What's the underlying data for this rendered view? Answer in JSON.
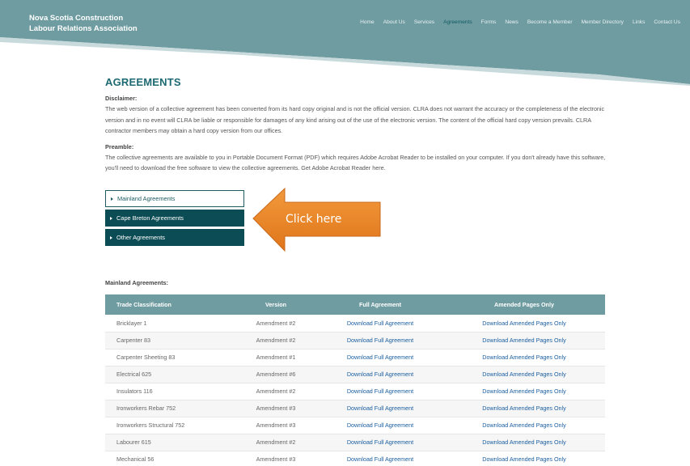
{
  "site": {
    "name_line1": "Nova Scotia Construction",
    "name_line2": "Labour Relations Association"
  },
  "nav": [
    {
      "label": "Home"
    },
    {
      "label": "About Us"
    },
    {
      "label": "Services"
    },
    {
      "label": "Agreements",
      "active": true
    },
    {
      "label": "Forms"
    },
    {
      "label": "News"
    },
    {
      "label": "Become a Member"
    },
    {
      "label": "Member Directory"
    },
    {
      "label": "Links"
    },
    {
      "label": "Contact Us"
    }
  ],
  "page": {
    "title": "AGREEMENTS",
    "disclaimer_label": "Disclaimer:",
    "disclaimer_text": "The web version of a collective agreement has been converted from its hard copy original and is not the official version. CLRA does not warrant the accuracy or the completeness of the electronic version and in no event will CLRA be liable or responsible for damages of any kind arising out of the use of the electronic version. The content of the official hard copy version prevails. CLRA contractor members may obtain a hard copy version from our offices.",
    "preamble_label": "Preamble:",
    "preamble_text": "The collective agreements are available to you in Portable Document Format (PDF) which requires Adobe Acrobat Reader to be installed on your computer. If you don't already have this software, you'll need to download the free software to view the collective agreements. Get Adobe Acrobat Reader here."
  },
  "accordion": [
    {
      "label": "Mainland Agreements"
    },
    {
      "label": "Cape Breton Agreements"
    },
    {
      "label": "Other Agreements"
    }
  ],
  "callout": {
    "text": "Click here",
    "color": "#ee8a2a"
  },
  "table": {
    "label": "Mainland Agreements:",
    "headers": [
      "Trade Classification",
      "Version",
      "Full Agreement",
      "Amended Pages Only"
    ],
    "rows": [
      {
        "trade": "Bricklayer 1",
        "version": "Amendment #2",
        "full": "Download Full Agreement",
        "amended": "Download Amended Pages Only"
      },
      {
        "trade": "Carpenter 83",
        "version": "Amendment #2",
        "full": "Download Full Agreement",
        "amended": "Download Amended Pages Only"
      },
      {
        "trade": "Carpenter Sheeting 83",
        "version": "Amendment #1",
        "full": "Download Full Agreement",
        "amended": "Download Amended Pages Only"
      },
      {
        "trade": "Electrical 625",
        "version": "Amendment #6",
        "full": "Download Full Agreement",
        "amended": "Download Amended Pages Only"
      },
      {
        "trade": "Insulators 116",
        "version": "Amendment #2",
        "full": "Download Full Agreement",
        "amended": "Download Amended Pages Only"
      },
      {
        "trade": "Ironworkers Rebar 752",
        "version": "Amendment #3",
        "full": "Download Full Agreement",
        "amended": "Download Amended Pages Only"
      },
      {
        "trade": "Ironworkers Structural 752",
        "version": "Amendment #3",
        "full": "Download Full Agreement",
        "amended": "Download Amended Pages Only"
      },
      {
        "trade": "Labourer 615",
        "version": "Amendment #2",
        "full": "Download Full Agreement",
        "amended": "Download Amended Pages Only"
      },
      {
        "trade": "Mechanical 56",
        "version": "Amendment #3",
        "full": "Download Full Agreement",
        "amended": "Download Amended Pages Only"
      }
    ]
  },
  "colors": {
    "header_teal": "#6f9ca1",
    "title_teal": "#1e6a72",
    "button_dark": "#0c4c55",
    "link_blue": "#1b5fa0"
  }
}
